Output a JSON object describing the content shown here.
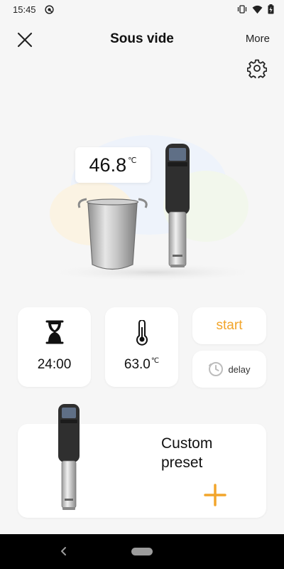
{
  "status_bar": {
    "time": "15:45"
  },
  "app_bar": {
    "title": "Sous vide",
    "more_label": "More"
  },
  "hero": {
    "current_temp": "46.8",
    "temp_unit": "℃"
  },
  "timer": {
    "value": "24:00"
  },
  "target_temp": {
    "value": "63.0",
    "unit": "℃"
  },
  "actions": {
    "start_label": "start",
    "delay_label": "delay"
  },
  "preset": {
    "label_line1": "Custom",
    "label_line2": "preset"
  },
  "colors": {
    "accent": "#f2a52b",
    "card": "#ffffff",
    "background": "#f6f6f6",
    "navbar": "#000000"
  },
  "icons": [
    "close-icon",
    "gear-icon",
    "hourglass-icon",
    "thermometer-icon",
    "clock-icon",
    "plus-icon",
    "back-icon"
  ]
}
